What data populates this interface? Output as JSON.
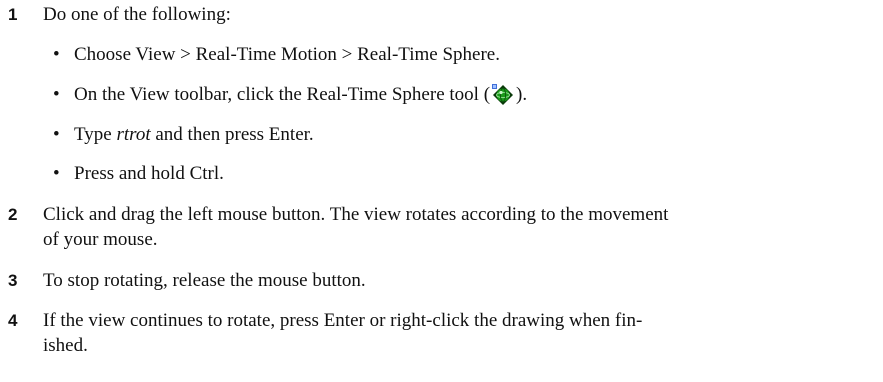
{
  "steps": [
    {
      "number": "1",
      "text": "Do one of the following:",
      "bullets": [
        {
          "marker": "•",
          "text": "Choose View > Real-Time Motion > Real-Time Sphere."
        },
        {
          "marker": "•",
          "text_before": "On the View toolbar, click the Real-Time Sphere tool (",
          "icon": "real-time-sphere-icon",
          "text_after": ")."
        },
        {
          "marker": "•",
          "text_before": "Type ",
          "italic": "rtrot",
          "text_after": " and then press Enter."
        },
        {
          "marker": "•",
          "text": "Press and hold Ctrl."
        }
      ]
    },
    {
      "number": "2",
      "line1": "Click and drag the left mouse button. The view rotates according to the movement",
      "line2": "of your mouse."
    },
    {
      "number": "3",
      "text": "To stop rotating, release the mouse button."
    },
    {
      "number": "4",
      "line1": "If the view continues to rotate, press Enter or right-click the drawing when fin-",
      "line2": "ished."
    }
  ],
  "icon_colors": {
    "sphere": "#1a9a1a",
    "outline": "#0a3a0a",
    "badge": "#3f6fd8"
  }
}
